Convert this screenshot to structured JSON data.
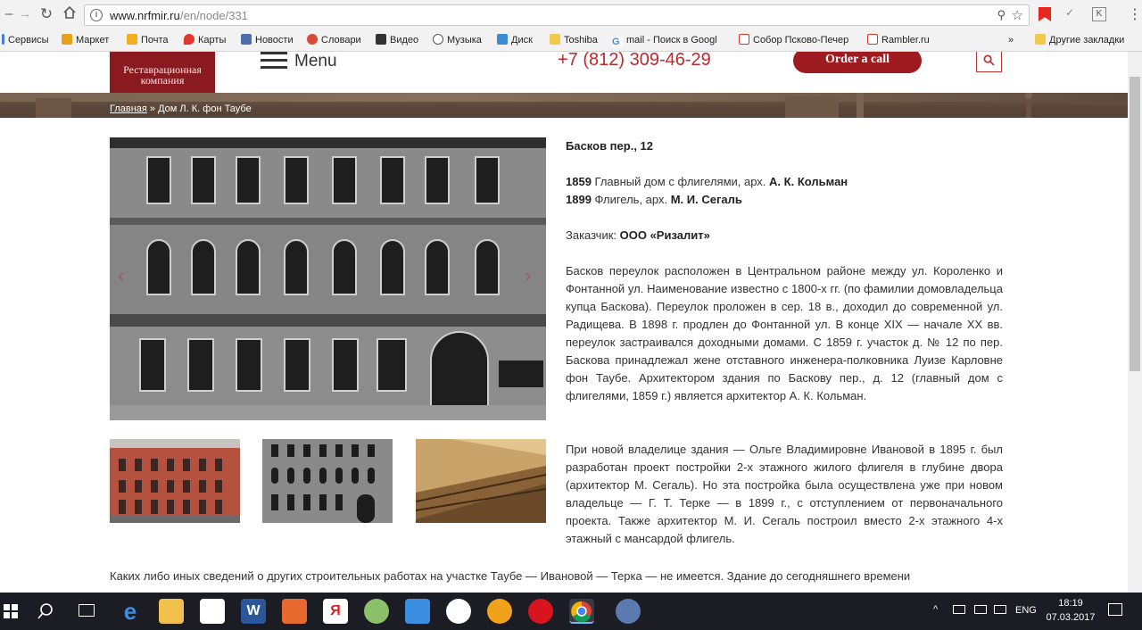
{
  "browser": {
    "url_host": "www.nrfmir.ru",
    "url_path": "/en/node/331",
    "bookmarks": [
      {
        "label": "Сервисы",
        "color": "#4a7fd6"
      },
      {
        "label": "Маркет",
        "color": "#e8a11a"
      },
      {
        "label": "Почта",
        "color": "#f2b01e"
      },
      {
        "label": "Карты",
        "color": "#e3372e"
      },
      {
        "label": "Новости",
        "color": "#4e6fae"
      },
      {
        "label": "Словари",
        "color": "#d84b3b"
      },
      {
        "label": "Видео",
        "color": "#333333"
      },
      {
        "label": "Музыка",
        "color": "#555555"
      },
      {
        "label": "Диск",
        "color": "#3d8ad8"
      },
      {
        "label": "Toshiba",
        "color": "#f4c84a"
      },
      {
        "label": "mail - Поиск в Googl",
        "color": "#4285f4"
      },
      {
        "label": "Собор Псково-Печер",
        "color": "#d9392c"
      },
      {
        "label": "Rambler.ru",
        "color": "#d9392c"
      },
      {
        "label": "»",
        "color": ""
      },
      {
        "label": "Другие закладки",
        "color": "#f4c84a"
      }
    ]
  },
  "site": {
    "logo_line1": "Реставрационная",
    "logo_line2": "компания",
    "menu_label": "Menu",
    "phone": "+7 (812) 309-46-29",
    "order_button": "Order a call",
    "breadcrumb_home": "Главная",
    "breadcrumb_sep": " » ",
    "breadcrumb_current": "Дом Л. К. фон Таубе"
  },
  "article": {
    "address": "Басков пер., 12",
    "line1_year": "1859",
    "line1_text": " Главный дом с флигелями, арх. ",
    "line1_architect": "А. К. Кольман",
    "line2_year": "1899",
    "line2_text": " Флигель, арх. ",
    "line2_architect": "М. И. Сегаль",
    "customer_label": "Заказчик: ",
    "customer_name": "ООО «Ризалит»",
    "paragraph1": "Басков переулок расположен в Центральном районе между ул. Короленко и Фонтанной ул. Наименование известно с 1800-х гг. (по фамилии домовладельца купца Баскова). Переулок проложен в сер. 18 в., доходил до современной ул. Радищева. В 1898 г. продлен до Фонтанной ул. В конце XIX — начале XX вв. переулок застраивался доходными домами. С 1859 г. участок д. № 12 по пер. Баскова принадлежал жене отставного инженера-полковника Луизе Карловне фон Таубе. Архитектором здания по Баскову пер., д. 12 (главный дом с флигелями, 1859 г.) является архитектор А. К. Кольман.",
    "paragraph2": "При новой владелице здания — Ольге Владимировне Ивановой в 1895 г. был разработан проект постройки 2-х этажного жилого флигеля в глубине двора (архитектор М. Сегаль). Но эта постройка была осуществлена уже при новом владельце — Г. Т. Терке — в 1899 г., с отступлением от первоначального проекта. Также архитектор М. И. Сегаль построил вместо 2-х этажного 4-х этажный с мансардой флигель.",
    "paragraph3": "Каких либо иных сведений о других строительных работах на участке Таубе — Ивановой — Терка — не имеется. Здание до сегодняшнего времени"
  },
  "taskbar": {
    "lang": "ENG",
    "time": "18:19",
    "date": "07.03.2017"
  }
}
